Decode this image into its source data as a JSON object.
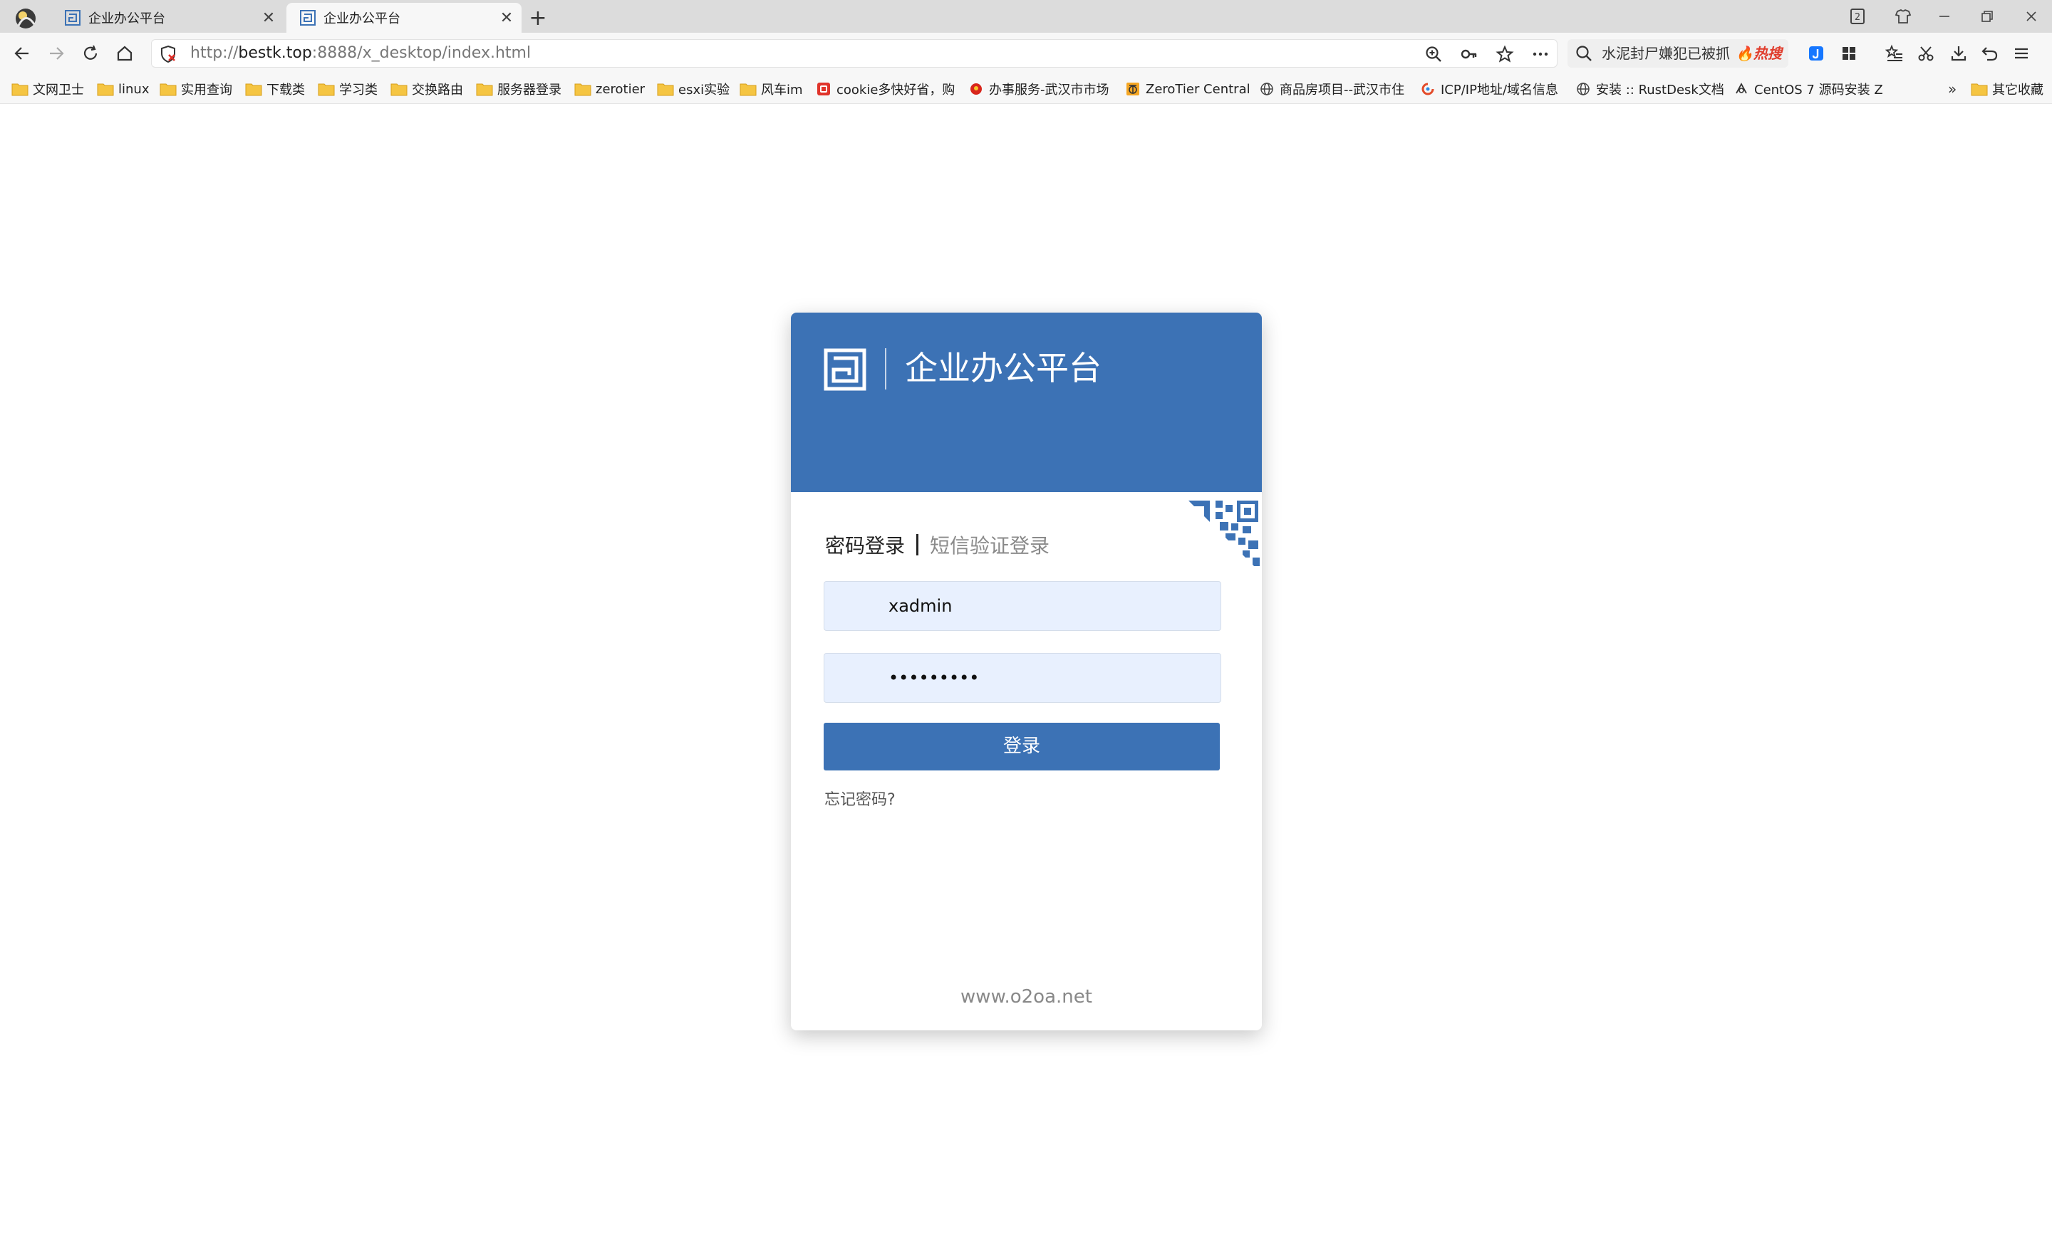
{
  "browser": {
    "tabs": [
      {
        "title": "企业办公平台",
        "active": false
      },
      {
        "title": "企业办公平台",
        "active": true
      }
    ],
    "tab_count_badge": "2",
    "address": {
      "scheme": "http://",
      "host": "bestk.top",
      "rest": ":8888/x_desktop/index.html"
    },
    "search": {
      "text": "水泥封尸嫌犯已被抓",
      "hot_label": "热搜"
    },
    "bookmarks": [
      {
        "label": "文网卫士",
        "icon": "folder-icon"
      },
      {
        "label": "linux",
        "icon": "folder-icon"
      },
      {
        "label": "实用查询",
        "icon": "folder-icon"
      },
      {
        "label": "下载类",
        "icon": "folder-icon"
      },
      {
        "label": "学习类",
        "icon": "folder-icon"
      },
      {
        "label": "交换路由",
        "icon": "folder-icon"
      },
      {
        "label": "服务器登录",
        "icon": "folder-icon"
      },
      {
        "label": "zerotier",
        "icon": "folder-icon"
      },
      {
        "label": "esxi实验",
        "icon": "folder-icon"
      },
      {
        "label": "风车im",
        "icon": "folder-icon"
      },
      {
        "label": "cookie多快好省，购",
        "icon": "site-icon"
      },
      {
        "label": "办事服务-武汉市市场",
        "icon": "emblem-icon"
      },
      {
        "label": "ZeroTier Central",
        "icon": "zerotier-icon"
      },
      {
        "label": "商品房项目--武汉市住",
        "icon": "globe-icon"
      },
      {
        "label": "ICP/IP地址/域名信息",
        "icon": "swirl-icon"
      },
      {
        "label": "安装 :: RustDesk文档",
        "icon": "globe-icon"
      },
      {
        "label": "CentOS 7 源码安装 Z",
        "icon": "centos-icon"
      }
    ],
    "bookmarks_more": "»",
    "other_bookmarks": "其它收藏"
  },
  "login": {
    "title": "企业办公平台",
    "tab_password": "密码登录",
    "tab_sms": "短信验证登录",
    "username_value": "xadmin",
    "password_value": "•••••••••",
    "login_button": "登录",
    "forgot": "忘记密码?",
    "footer": "www.o2oa.net"
  },
  "colors": {
    "brand": "#3c72b5",
    "field_bg": "#e8f0fe"
  }
}
